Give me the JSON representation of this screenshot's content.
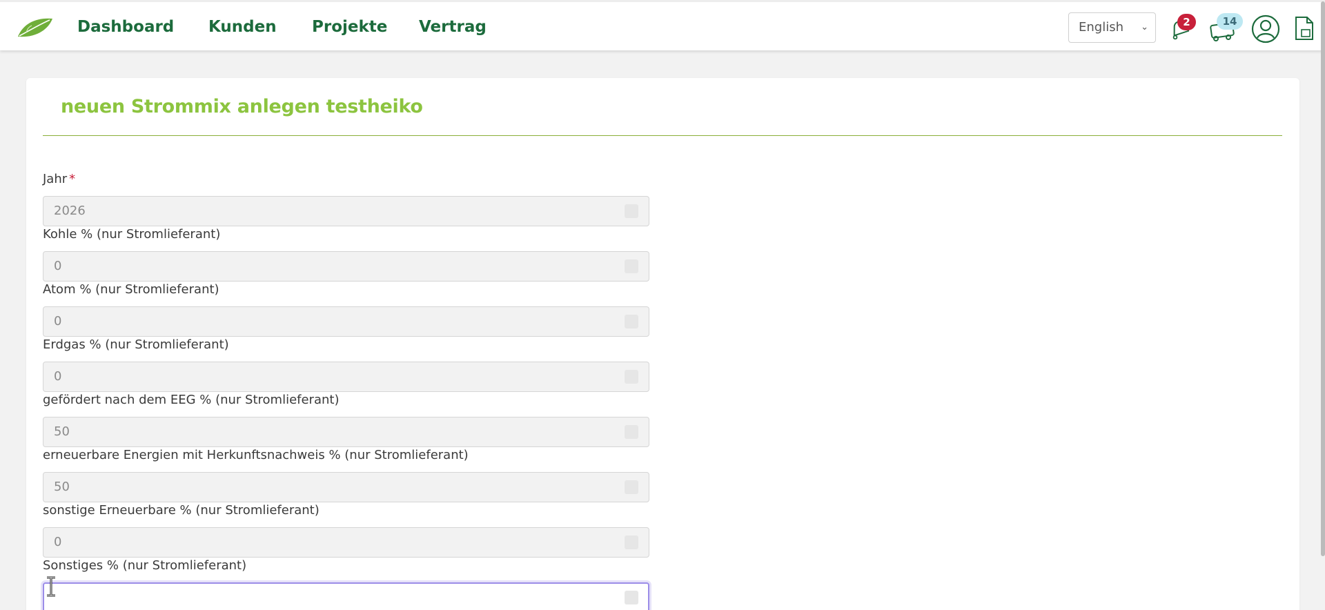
{
  "nav": {
    "links": [
      {
        "label": "Dashboard"
      },
      {
        "label": "Kunden"
      },
      {
        "label": "Projekte"
      },
      {
        "label": "Vertrag"
      }
    ]
  },
  "header": {
    "language": "English",
    "notifications_count": "2",
    "messages_count": "14"
  },
  "form": {
    "title": "neuen Strommix anlegen testheiko",
    "fields": [
      {
        "label": "Jahr",
        "required_mark": "*",
        "value": "2026"
      },
      {
        "label": "Kohle % (nur Stromlieferant)",
        "value": "0"
      },
      {
        "label": "Atom % (nur Stromlieferant)",
        "value": "0"
      },
      {
        "label": "Erdgas % (nur Stromlieferant)",
        "value": "0"
      },
      {
        "label": "gefördert nach dem EEG % (nur Stromlieferant)",
        "value": "50"
      },
      {
        "label": "erneuerbare Energien mit Herkunftsnachweis % (nur Stromlieferant)",
        "value": "50"
      },
      {
        "label": "sonstige Erneuerbare % (nur Stromlieferant)",
        "value": "0"
      },
      {
        "label": "Sonstiges % (nur Stromlieferant)",
        "value": ""
      }
    ]
  },
  "colors": {
    "nav_green": "#1c6b3c",
    "title_green": "#8cc43f",
    "badge_red": "#c8203a",
    "badge_blue": "#bde8f2",
    "focus_purple": "#9b8ce8"
  },
  "icons": [
    "leaf-logo-icon",
    "bell-icon",
    "bus-icon",
    "user-icon",
    "document-icon",
    "chevron-down-icon",
    "spinner-arrows-icon",
    "text-cursor-icon"
  ]
}
